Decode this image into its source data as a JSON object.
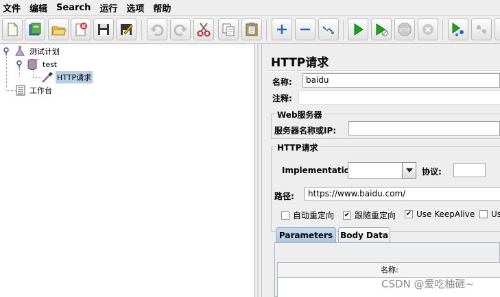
{
  "menu": [
    "文件",
    "编辑",
    "Search",
    "运行",
    "选项",
    "帮助"
  ],
  "tree": {
    "test_plan": "测试计划",
    "thread_group": "test",
    "sampler": "HTTP请求",
    "workbench": "工作台"
  },
  "panel": {
    "title": "HTTP请求",
    "name_label": "名称:",
    "name_value": "baidu",
    "comment_label": "注释:",
    "comment_value": "",
    "web_server_title": "Web服务器",
    "server_label": "服务器名称或IP:",
    "server_value": "",
    "http_request_title": "HTTP请求",
    "implementation_label": "Implementation:",
    "implementation_value": "",
    "protocol_label": "协议:",
    "protocol_value": "",
    "path_label": "路径:",
    "path_value": "https://www.baidu.com/",
    "checkboxes": [
      {
        "label": "自动重定向",
        "checked": false
      },
      {
        "label": "跟随重定向",
        "checked": true
      },
      {
        "label": "Use KeepAlive",
        "checked": true
      },
      {
        "label": "Us",
        "checked": false
      }
    ],
    "tabs": [
      "Parameters",
      "Body Data"
    ],
    "table_header": "名称:"
  },
  "watermark": "CSDN @爱吃柚砸~",
  "colors": {
    "play_green": "#1aa31a",
    "selection": "#b8cfe5",
    "add_blue": "#2a62c9",
    "cut_red": "#c82020"
  },
  "toolbar_icons": [
    "new-icon",
    "templates-icon",
    "open-icon",
    "close-icon",
    "save-icon",
    "save-as-icon",
    "undo-icon",
    "redo-icon",
    "cut-icon",
    "copy-icon",
    "paste-icon",
    "expand-icon",
    "collapse-icon",
    "toggle-icon",
    "start-icon",
    "start-no-pause-icon",
    "stop-icon",
    "shutdown-icon",
    "remote-start-icon",
    "remote-icon"
  ]
}
